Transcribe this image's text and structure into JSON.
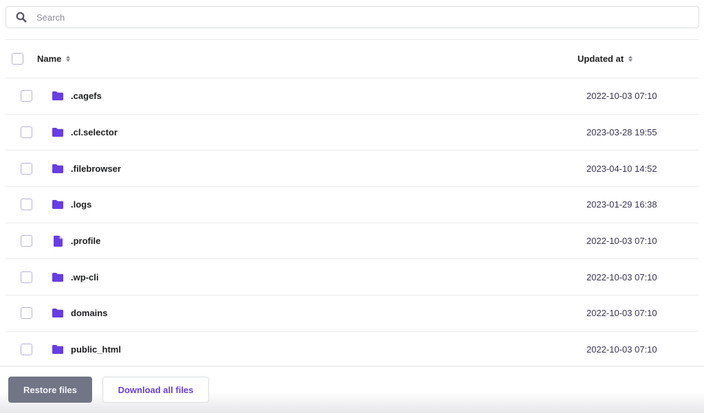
{
  "search": {
    "placeholder": "Search",
    "value": ""
  },
  "table": {
    "columns": {
      "name": "Name",
      "updated_at": "Updated at"
    },
    "rows": [
      {
        "name": ".cagefs",
        "type": "folder",
        "updated_at": "2022-10-03 07:10"
      },
      {
        "name": ".cl.selector",
        "type": "folder",
        "updated_at": "2023-03-28 19:55"
      },
      {
        "name": ".filebrowser",
        "type": "folder",
        "updated_at": "2023-04-10 14:52"
      },
      {
        "name": ".logs",
        "type": "folder",
        "updated_at": "2023-01-29 16:38"
      },
      {
        "name": ".profile",
        "type": "file",
        "updated_at": "2022-10-03 07:10"
      },
      {
        "name": ".wp-cli",
        "type": "folder",
        "updated_at": "2022-10-03 07:10"
      },
      {
        "name": "domains",
        "type": "folder",
        "updated_at": "2022-10-03 07:10"
      },
      {
        "name": "public_html",
        "type": "folder",
        "updated_at": "2022-10-03 07:10"
      }
    ]
  },
  "actions": {
    "restore_label": "Restore files",
    "download_label": "Download all files"
  },
  "colors": {
    "accent": "#673de6",
    "icon": "#673de6",
    "restore_bg": "#727586"
  }
}
